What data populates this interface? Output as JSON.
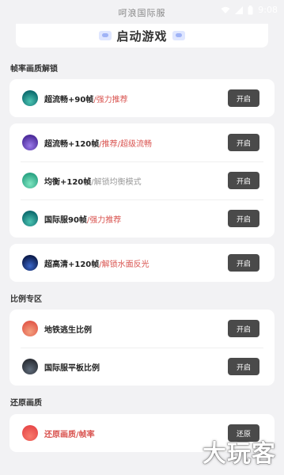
{
  "status_bar": {
    "title": "呵浪国际服",
    "time": "9:08"
  },
  "launch": {
    "label": "启动游戏"
  },
  "sections": {
    "fps": "帧率画质解锁",
    "ratio": "比例专区",
    "restore": "还原画质"
  },
  "cards": {
    "c1": [
      {
        "title": "超流畅+90帧",
        "sub": "/强力推荐",
        "sub_color": "#d9534f",
        "button": "开启",
        "icon_colors": [
          "#0c6b6e",
          "#4cc4b2"
        ]
      }
    ],
    "c2": [
      {
        "title": "超流畅+120帧",
        "sub": "/推荐/超级流畅",
        "sub_color": "#d9534f",
        "button": "开启",
        "icon_colors": [
          "#4b2a9a",
          "#9a7ae8"
        ]
      },
      {
        "title": "均衡+120帧",
        "sub": "/解锁均衡模式",
        "sub_color": "#9a9a9a",
        "button": "开启",
        "icon_colors": [
          "#2aa383",
          "#7fe6c1"
        ]
      },
      {
        "title": "国际服90帧",
        "sub": "/强力推荐",
        "sub_color": "#d9534f",
        "button": "开启",
        "icon_colors": [
          "#0c6b6e",
          "#4cc4b2"
        ]
      }
    ],
    "c3": [
      {
        "title": "超高清+120帧",
        "sub": "/解锁水面反光",
        "sub_color": "#d9534f",
        "button": "开启",
        "icon_colors": [
          "#0a1a4a",
          "#3a66c8"
        ]
      }
    ],
    "c4": [
      {
        "title": "地铁逃生比例",
        "sub": "",
        "sub_color": "#d9534f",
        "button": "开启",
        "icon_colors": [
          "#e25a4a",
          "#f3a07e"
        ]
      },
      {
        "title": "国际服平板比例",
        "sub": "",
        "sub_color": "#d9534f",
        "button": "开启",
        "icon_colors": [
          "#2a2e35",
          "#5f6b7a"
        ]
      }
    ],
    "c5": [
      {
        "title": "还原画质/帧率",
        "sub": "",
        "sub_color": "#d9534f",
        "button": "还原",
        "title_color": "#d9534f",
        "icon_colors": [
          "#e84a4a",
          "#f77a6c"
        ]
      }
    ]
  },
  "watermark": "大玩客"
}
